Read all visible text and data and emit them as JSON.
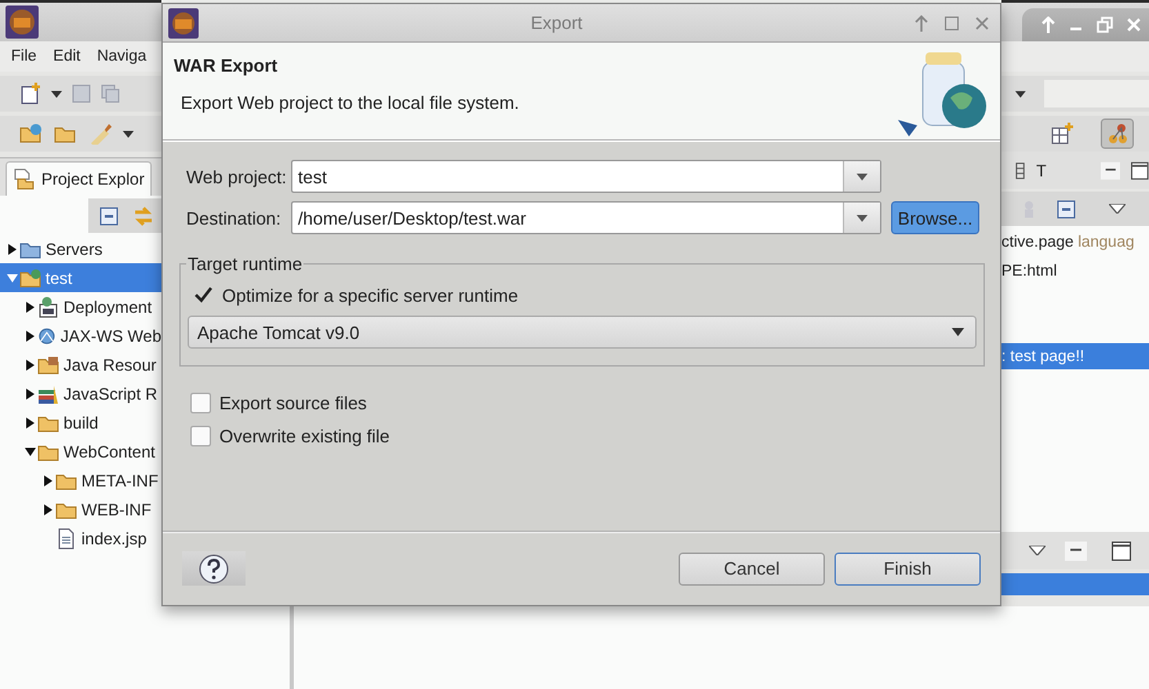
{
  "ide": {
    "menu": [
      "File",
      "Edit",
      "Naviga"
    ],
    "project_explorer": {
      "tab": "Project Explor",
      "tree": [
        {
          "label": "Servers",
          "kind": "servers",
          "expanded": false,
          "selected": false
        },
        {
          "label": "test",
          "kind": "project",
          "expanded": true,
          "selected": true,
          "children": [
            {
              "label": "Deployment",
              "kind": "descriptor",
              "expanded": false,
              "selected": false
            },
            {
              "label": "JAX-WS Web",
              "kind": "webservices",
              "expanded": false,
              "selected": false
            },
            {
              "label": "Java Resour",
              "kind": "java",
              "expanded": false,
              "selected": false
            },
            {
              "label": "JavaScript R",
              "kind": "javascript",
              "expanded": false,
              "selected": false
            },
            {
              "label": "build",
              "kind": "folder",
              "expanded": false,
              "selected": false
            },
            {
              "label": "WebContent",
              "kind": "folder",
              "expanded": true,
              "selected": false,
              "children": [
                {
                  "label": "META-INF",
                  "kind": "folder",
                  "expanded": false,
                  "selected": false
                },
                {
                  "label": "WEB-INF",
                  "kind": "folder",
                  "expanded": false,
                  "selected": false
                },
                {
                  "label": "index.jsp",
                  "kind": "file",
                  "selected": false
                }
              ]
            }
          ]
        }
      ]
    },
    "editor": {
      "tab": "T",
      "lines": [
        {
          "parts": [
            {
              "kind": "plain",
              "text": "ctive.page"
            },
            {
              "kind": "attribute",
              "text": "languag"
            }
          ],
          "selected": false
        },
        {
          "parts": [
            {
              "kind": "plain",
              "text": "PE:html"
            }
          ],
          "selected": false
        },
        {
          "parts": [
            {
              "kind": "plain",
              "text": ": test page!!"
            }
          ],
          "selected": true
        }
      ]
    }
  },
  "dialog": {
    "title": "Export",
    "heading": "WAR Export",
    "description": "Export Web project to the local file system.",
    "fields": [
      {
        "label": "Web project:",
        "value": "test"
      },
      {
        "label": "Destination:",
        "value": "/home/user/Desktop/test.war"
      }
    ],
    "browse_button": {
      "label": "Browse...",
      "focused": true
    },
    "group": {
      "title": "Target runtime",
      "checkbox": {
        "label": "Optimize for a specific server runtime",
        "checked": true
      },
      "runtime": "Apache Tomcat v9.0"
    },
    "options": [
      {
        "label": "Export source files",
        "checked": false
      },
      {
        "label": "Overwrite existing file",
        "checked": false
      }
    ],
    "buttons": [
      {
        "label": "Cancel",
        "default": false
      },
      {
        "label": "Finish",
        "default": true
      }
    ]
  }
}
